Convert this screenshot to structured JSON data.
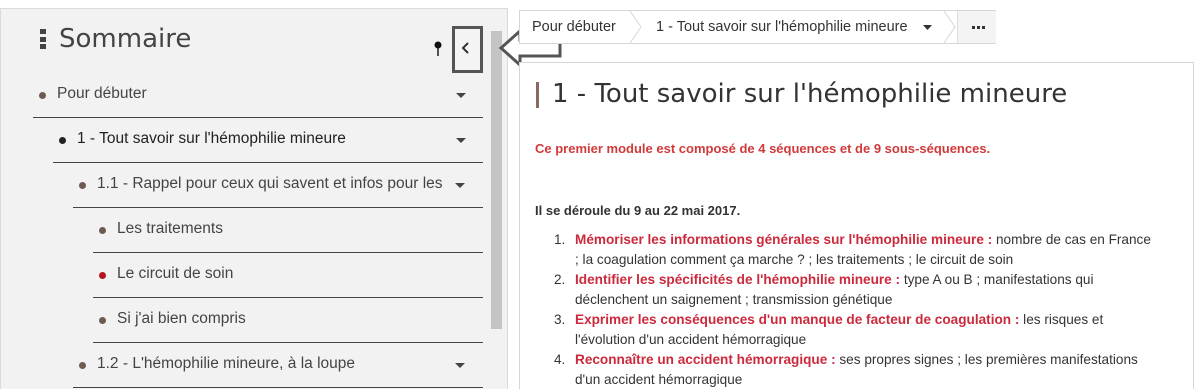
{
  "sidebar": {
    "title": "Sommaire",
    "items": [
      {
        "label": "Pour débuter"
      },
      {
        "label": "1 - Tout savoir sur l'hémophilie mineure"
      },
      {
        "label": "1.1 - Rappel pour ceux qui savent et infos pour les"
      },
      {
        "label": "Les traitements"
      },
      {
        "label": "Le circuit de soin"
      },
      {
        "label": "Si j'ai bien compris"
      },
      {
        "label": "1.2 - L'hémophilie mineure, à la loupe"
      }
    ]
  },
  "breadcrumb": {
    "items": [
      {
        "label": "Pour débuter"
      },
      {
        "label": "1 - Tout savoir sur l'hémophilie mineure"
      }
    ]
  },
  "content": {
    "title": "1 - Tout savoir sur l'hémophilie mineure",
    "intro": "Ce premier module est composé de 4 séquences et de 9 sous-séquences.",
    "dates": "Il se déroule du 9 au 22 mai 2017.",
    "sequences": [
      {
        "num": "1.",
        "highlight": "Mémoriser les informations générales sur l'hémophilie mineure :",
        "text": " nombre de cas en France ; la coagulation comment ça marche ? ; les traitements ; le circuit de soin"
      },
      {
        "num": "2.",
        "highlight": "Identifier les spécificités de l'hémophilie mineure :",
        "text": " type A ou B ; manifestations qui déclenchent un saignement ; transmission génétique"
      },
      {
        "num": "3.",
        "highlight": "Exprimer les conséquences d'un manque de facteur de coagulation :",
        "text": " les risques et l'évolution d'un accident hémorragique"
      },
      {
        "num": "4.",
        "highlight": "Reconnaître un accident hémorragique :",
        "text": " ses propres signes ; les premières manifestations d'un accident hémorragique"
      }
    ]
  },
  "colors": {
    "accent_red": "#cc2a3c",
    "intro_red": "#d13a3a",
    "dot_brown": "#6f5a52",
    "dot_red": "#b3141e",
    "sidebar_bg": "#f2f2f2"
  }
}
